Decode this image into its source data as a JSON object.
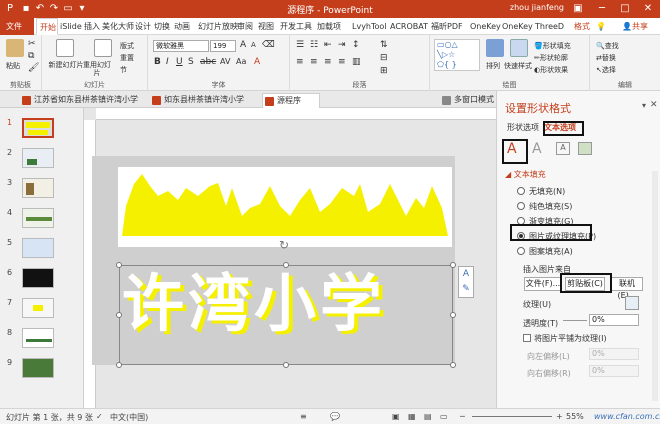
{
  "titlebar": {
    "title": "源程序 - PowerPoint",
    "user": "zhou jianfeng"
  },
  "tabs": [
    "文件",
    "开始",
    "iSlide",
    "插入",
    "美化大师",
    "设计",
    "切换",
    "动画",
    "幻灯片放映",
    "审阅",
    "视图",
    "开发工具",
    "加载项",
    "LvyhTool",
    "ACROBAT",
    "福昕PDF",
    "OneKey",
    "OneKey",
    "ThreeD",
    "格式"
  ],
  "share": "共享",
  "ribbon": {
    "paste": "粘贴",
    "new_slide": "新建幻灯片",
    "reset": "重置",
    "reuse": "重用幻灯片",
    "section": "节",
    "layout": "版式",
    "font_name": "微软雅黑",
    "font_size": "199",
    "groups": {
      "clipboard": "剪贴板",
      "slides": "幻灯片",
      "font": "字体",
      "paragraph": "段落",
      "drawing": "绘图",
      "editing": "编辑"
    },
    "arrange": "排列",
    "quick_styles": "快速样式",
    "shape_fill": "形状填充",
    "shape_outline": "形状轮廓",
    "shape_effects": "形状效果",
    "find": "查找",
    "replace": "替换",
    "select": "选择"
  },
  "doctabs": [
    "江苏省如东县栟茶镇许湾小学",
    "如东县栟茶镇许湾小学",
    "源程序",
    "多窗口模式"
  ],
  "slide": {
    "text": "许湾小学"
  },
  "thumb_numbers": [
    "1",
    "2",
    "3",
    "4",
    "5",
    "6",
    "7",
    "8",
    "9"
  ],
  "pane": {
    "title": "设置形状格式",
    "tab_shape": "形状选项",
    "tab_text": "文本选项",
    "section": "文本填充",
    "opt_none": "无填充(N)",
    "opt_solid": "纯色填充(S)",
    "opt_gradient": "渐变填充(G)",
    "opt_picture": "图片或纹理填充(P)",
    "opt_pattern": "图案填充(A)",
    "insert_from": "插入图片来自",
    "btn_file": "文件(F)...",
    "btn_clipboard": "剪贴板(C)",
    "btn_online": "联机(E)...",
    "texture": "纹理(U)",
    "transparency": "透明度(T)",
    "transparency_value": "0%",
    "tile": "将图片平铺为纹理(I)",
    "offset_left": "向左偏移(L)",
    "offset_right": "向右偏移(R)",
    "offset_left_value": "0%",
    "offset_right_value": "0%"
  },
  "status": {
    "slide_info": "幻灯片 第 1 张，共 9 张",
    "lang": "中文(中国)",
    "zoom": "55%"
  },
  "watermark": "www.cfan.com.cn",
  "colors": {
    "accent": "#c43e1c",
    "yellow": "#f4f000"
  }
}
